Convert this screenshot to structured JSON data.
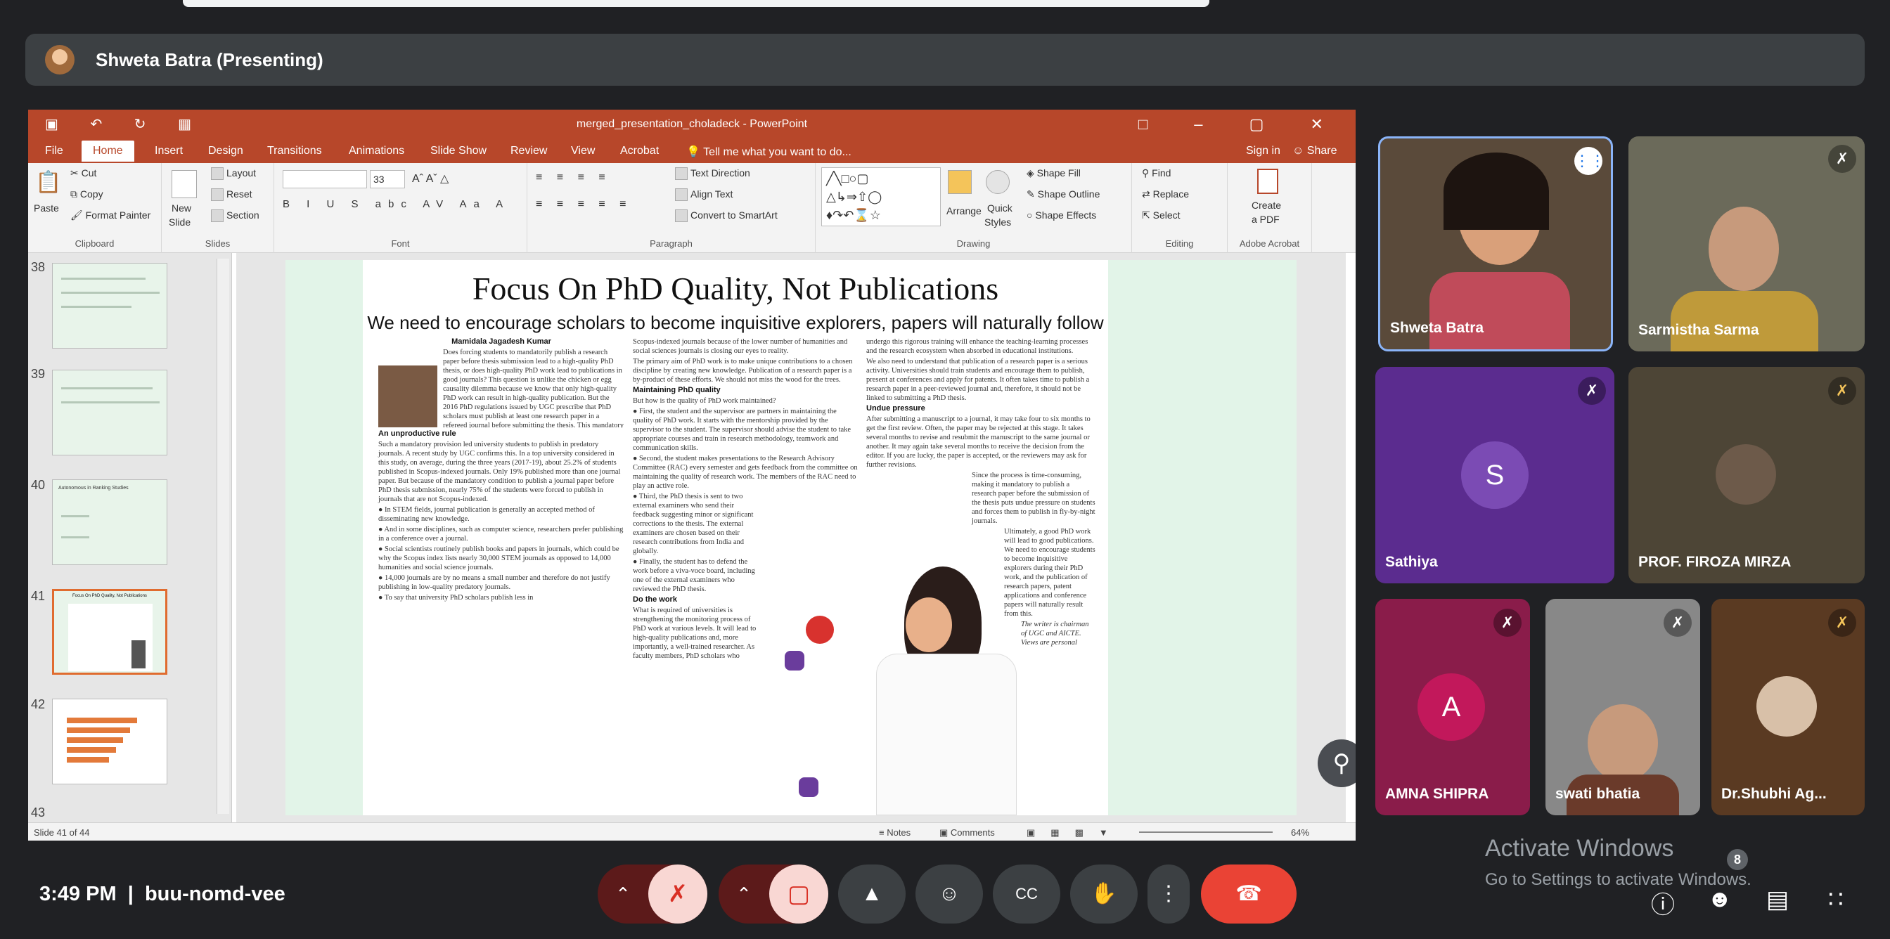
{
  "presenter": {
    "label": "Shweta Batra (Presenting)"
  },
  "powerpoint": {
    "title": "merged_presentation_choladeck - PowerPoint",
    "tabs": [
      "File",
      "Home",
      "Insert",
      "Design",
      "Transitions",
      "Animations",
      "Slide Show",
      "Review",
      "View",
      "Acrobat"
    ],
    "tell_me": "Tell me what you want to do...",
    "sign_in": "Sign in",
    "share": "Share",
    "ribbon": {
      "clipboard": {
        "paste": "Paste",
        "cut": "Cut",
        "copy": "Copy",
        "format_painter": "Format Painter",
        "label": "Clipboard"
      },
      "slides": {
        "new_slide": "New",
        "new_slide2": "Slide",
        "layout": "Layout",
        "reset": "Reset",
        "section": "Section",
        "label": "Slides"
      },
      "font": {
        "size": "33",
        "label": "Font"
      },
      "paragraph": {
        "text_direction": "Text Direction",
        "align_text": "Align Text",
        "convert": "Convert to SmartArt",
        "label": "Paragraph"
      },
      "drawing": {
        "arrange": "Arrange",
        "quick": "Quick",
        "styles": "Styles",
        "shape_fill": "Shape Fill",
        "shape_outline": "Shape Outline",
        "shape_effects": "Shape Effects",
        "label": "Drawing"
      },
      "editing": {
        "find": "Find",
        "replace": "Replace",
        "select": "Select",
        "label": "Editing"
      },
      "acrobat": {
        "create": "Create",
        "pdf": "a PDF",
        "label": "Adobe Acrobat"
      }
    },
    "thumbnails": [
      {
        "num": "38"
      },
      {
        "num": "39"
      },
      {
        "num": "40"
      },
      {
        "num": "41"
      },
      {
        "num": "42"
      },
      {
        "num": "43"
      }
    ],
    "thumb40_title": "Autonomous in Ranking Studies",
    "thumb41_title": "Focus On PhD Quality, Not Publications",
    "article": {
      "headline": "Focus On PhD Quality, Not Publications",
      "subhead": "We need to encourage scholars to become inquisitive explorers, papers will naturally follow",
      "byline": "Mamidala Jagadesh Kumar",
      "col1_intro": "Does forcing students to mandatorily publish a research paper before thesis submission lead to a high-quality PhD thesis, or does high-quality PhD work lead to publications in good journals? This question is unlike the chicken or egg causality dilemma because we know that only high-quality PhD work can result in high-quality publication. But the 2016 PhD regulations issued by UGC prescribe that PhD scholars must publish at least one research paper in a refereed journal before submitting the thesis. This mandatory publication condition was introduced by UGC apparently because the doctoral thesis screening isn't rigorous enough.",
      "col1_h": "An unproductive rule",
      "col1_p2": "Such a mandatory provision led university students to publish in predatory journals. A recent study by UGC confirms this. In a top university considered in this study, on average, during the three years (2017-19), about 25.2% of students published in Scopus-indexed journals. Only 19% published more than one journal paper. But because of the mandatory condition to publish a journal paper before PhD thesis submission, nearly 75% of the students were forced to publish in journals that are not Scopus-indexed.",
      "col1_b1": "In STEM fields, journal publication is generally an accepted method of disseminating new knowledge.",
      "col1_b2": "And in some disciplines, such as computer science, researchers prefer publishing in a conference over a journal.",
      "col1_b3": "Social scientists routinely publish books and papers in journals, which could be why the Scopus index lists nearly 30,000 STEM journals as opposed to 14,000 humanities and social science journals.",
      "col1_b4": "14,000 journals are by no means a small number and therefore do not justify publishing in low-quality predatory journals.",
      "col1_b5": "To say that university PhD scholars publish less in",
      "col2_p1": "Scopus-indexed journals because of the lower number of humanities and social sciences journals is closing our eyes to reality.",
      "col2_p2": "The primary aim of PhD work is to make unique contributions to a chosen discipline by creating new knowledge. Publication of a research paper is a by-product of these efforts. We should not miss the wood for the trees.",
      "col2_h": "Maintaining PhD quality",
      "col2_p3": "But how is the quality of PhD work maintained?",
      "col2_b1": "First, the student and the supervisor are partners in maintaining the quality of PhD work. It starts with the mentorship provided by the supervisor to the student. The supervisor should advise the student to take appropriate courses and train in research methodology, teamwork and communication skills.",
      "col2_b2": "Second, the student makes presentations to the Research Advisory Committee (RAC) every semester and gets feedback from the committee on maintaining the quality of research work. The members of the RAC need to play an active role.",
      "col2_b3": "Third, the PhD thesis is sent to two external examiners who send their feedback suggesting minor or significant corrections to the thesis. The external examiners are chosen based on their research contributions from India and globally.",
      "col2_b4": "Finally, the student has to defend the work before a viva-voce board, including one of the external examiners who reviewed the PhD thesis.",
      "col2_h2": "Do the work",
      "col2_p4": "What is required of universities is strengthening the monitoring process of PhD work at various levels. It will lead to high-quality publications and, more importantly, a well-trained researcher. As faculty members, PhD scholars who",
      "col3_p1": "undergo this rigorous training will enhance the teaching-learning processes and the research ecosystem when absorbed in educational institutions.",
      "col3_p2": "We also need to understand that publication of a research paper is a serious activity. Universities should train students and encourage them to publish, present at conferences and apply for patents. It often takes time to publish a research paper in a peer-reviewed journal and, therefore, it should not be linked to submitting a PhD thesis.",
      "col3_h": "Undue pressure",
      "col3_p3": "After submitting a manuscript to a journal, it may take four to six months to get the first review. Often, the paper may be rejected at this stage. It takes several months to revise and resubmit the manuscript to the same journal or another. It may again take several months to receive the decision from the editor. If you are lucky, the paper is accepted, or the reviewers may ask for further revisions.",
      "col3_p4": "Since the process is time-consuming, making it mandatory to publish a research paper before the submission of the thesis puts undue pressure on students and forces them to publish in fly-by-night journals.",
      "col3_p5": "Ultimately, a good PhD work will lead to good publications. We need to encourage students to become inquisitive explorers during their PhD work, and the publication of research papers, patent applications and conference papers will naturally result from this.",
      "col3_foot": "The writer is chairman of UGC and AICTE. Views are personal"
    },
    "status": {
      "slide": "Slide 41 of 44",
      "notes": "Notes",
      "comments": "Comments",
      "zoom": "64%"
    }
  },
  "participants": [
    {
      "name": "Shweta Batra",
      "bg": "#5a4a3a"
    },
    {
      "name": "Sarmistha Sarma",
      "bg": "#6b6a5a"
    },
    {
      "name": "Sathiya",
      "initial": "S",
      "bg": "#5b2c8f",
      "circle": "#7b4bb4"
    },
    {
      "name": "PROF. FIROZA MIRZA",
      "bg": "#4d4536"
    },
    {
      "name": "AMNA SHIPRA",
      "initial": "A",
      "bg": "#8a1c4a",
      "circle": "#c2185b"
    },
    {
      "name": "swati bhatia",
      "bg": "#777"
    },
    {
      "name": "Dr.Shubhi Ag...",
      "bg": "#5a3a22"
    }
  ],
  "activate": {
    "line1": "Activate Windows",
    "line2": "Go to Settings to activate Windows."
  },
  "meeting": {
    "time": "3:49 PM",
    "code": "buu-nomd-vee",
    "people_count": "8"
  }
}
